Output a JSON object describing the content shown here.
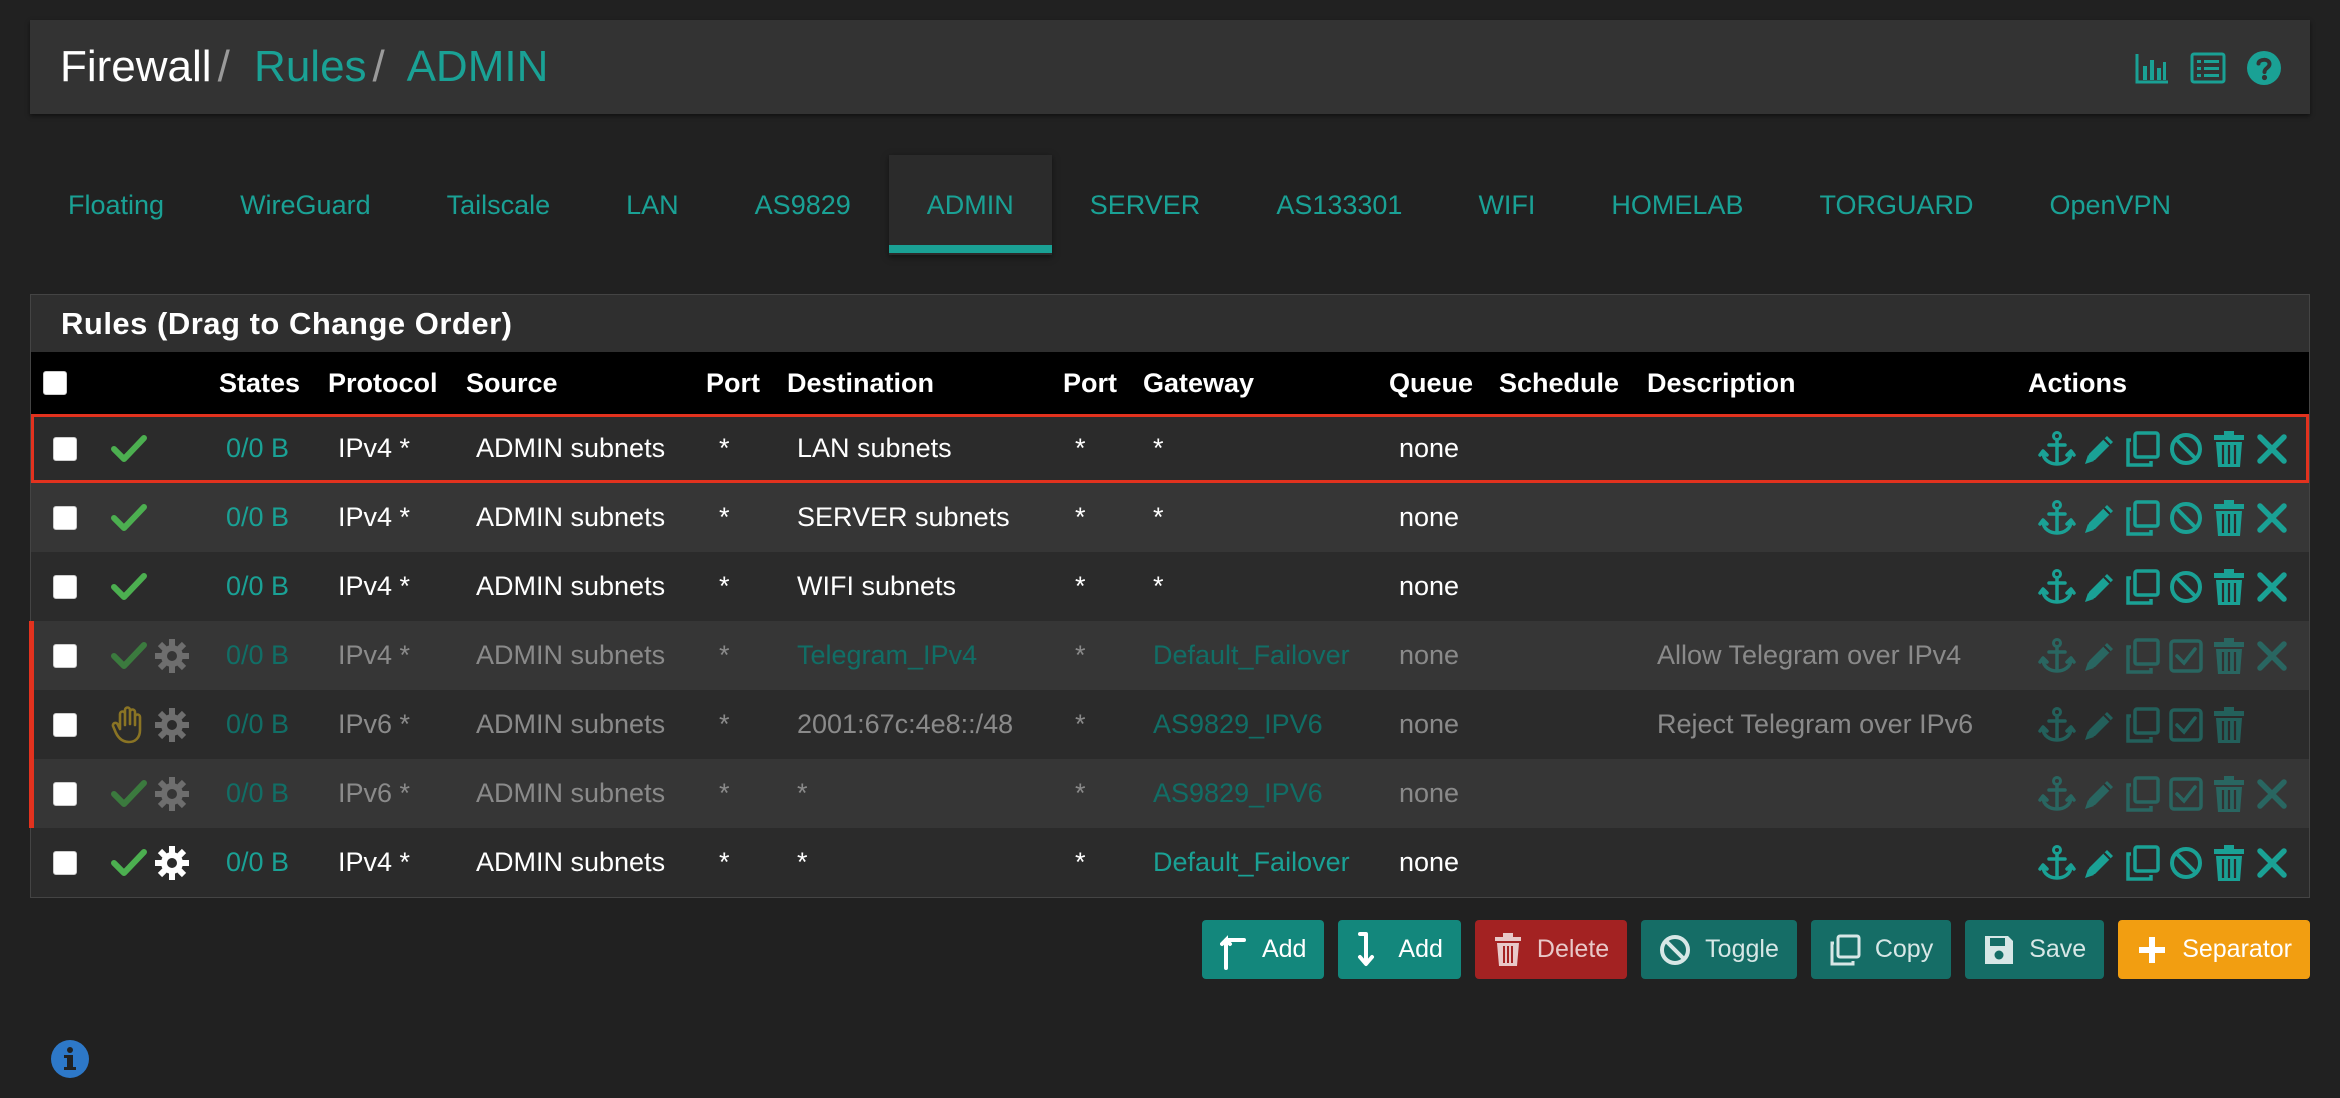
{
  "breadcrumb": {
    "items": [
      {
        "label": "Firewall"
      },
      {
        "label": "Rules"
      },
      {
        "label": "ADMIN"
      }
    ],
    "separator": "/"
  },
  "header_icons": [
    "chart-icon",
    "list-icon",
    "help-icon"
  ],
  "tabs": [
    {
      "label": "Floating",
      "active": false
    },
    {
      "label": "WireGuard",
      "active": false
    },
    {
      "label": "Tailscale",
      "active": false
    },
    {
      "label": "LAN",
      "active": false
    },
    {
      "label": "AS9829",
      "active": false
    },
    {
      "label": "ADMIN",
      "active": true
    },
    {
      "label": "SERVER",
      "active": false
    },
    {
      "label": "AS133301",
      "active": false
    },
    {
      "label": "WIFI",
      "active": false
    },
    {
      "label": "HOMELAB",
      "active": false
    },
    {
      "label": "TORGUARD",
      "active": false
    },
    {
      "label": "OpenVPN",
      "active": false
    }
  ],
  "panel": {
    "title": "Rules (Drag to Change Order)",
    "columns": {
      "states": "States",
      "protocol": "Protocol",
      "source": "Source",
      "port1": "Port",
      "destination": "Destination",
      "port2": "Port",
      "gateway": "Gateway",
      "queue": "Queue",
      "schedule": "Schedule",
      "description": "Description",
      "actions": "Actions"
    }
  },
  "rows": [
    {
      "status": "pass",
      "gear": false,
      "disabled": false,
      "highlighted": true,
      "states": "0/0 B",
      "protocol": "IPv4 *",
      "source": "ADMIN subnets",
      "port1": "*",
      "destination": "LAN subnets",
      "destination_link": false,
      "port2": "*",
      "gateway": "*",
      "gateway_link": false,
      "queue": "none",
      "schedule": "",
      "description": "",
      "toggle": "disable",
      "delete_rule": true
    },
    {
      "status": "pass",
      "gear": false,
      "disabled": false,
      "highlighted": false,
      "states": "0/0 B",
      "protocol": "IPv4 *",
      "source": "ADMIN subnets",
      "port1": "*",
      "destination": "SERVER subnets",
      "destination_link": false,
      "port2": "*",
      "gateway": "*",
      "gateway_link": false,
      "queue": "none",
      "schedule": "",
      "description": "",
      "toggle": "disable",
      "delete_rule": true
    },
    {
      "status": "pass",
      "gear": false,
      "disabled": false,
      "highlighted": false,
      "states": "0/0 B",
      "protocol": "IPv4 *",
      "source": "ADMIN subnets",
      "port1": "*",
      "destination": "WIFI subnets",
      "destination_link": false,
      "port2": "*",
      "gateway": "*",
      "gateway_link": false,
      "queue": "none",
      "schedule": "",
      "description": "",
      "toggle": "disable",
      "delete_rule": true
    },
    {
      "status": "pass",
      "gear": true,
      "disabled": true,
      "highlighted": false,
      "states": "0/0 B",
      "protocol": "IPv4 *",
      "source": "ADMIN subnets",
      "port1": "*",
      "destination": "Telegram_IPv4",
      "destination_link": true,
      "port2": "*",
      "gateway": "Default_Failover",
      "gateway_link": true,
      "queue": "none",
      "schedule": "",
      "description": "Allow Telegram over IPv4",
      "toggle": "enable",
      "delete_rule": true
    },
    {
      "status": "reject",
      "gear": true,
      "disabled": true,
      "highlighted": false,
      "states": "0/0 B",
      "protocol": "IPv6 *",
      "source": "ADMIN subnets",
      "port1": "*",
      "destination": "2001:67c:4e8::/48",
      "destination_link": false,
      "port2": "*",
      "gateway": "AS9829_IPV6",
      "gateway_link": true,
      "queue": "none",
      "schedule": "",
      "description": "Reject Telegram over IPv6",
      "toggle": "enable",
      "delete_rule": false
    },
    {
      "status": "pass",
      "gear": true,
      "disabled": true,
      "highlighted": false,
      "states": "0/0 B",
      "protocol": "IPv6 *",
      "source": "ADMIN subnets",
      "port1": "*",
      "destination": "*",
      "destination_link": false,
      "port2": "*",
      "gateway": "AS9829_IPV6",
      "gateway_link": true,
      "queue": "none",
      "schedule": "",
      "description": "",
      "toggle": "enable",
      "delete_rule": true
    },
    {
      "status": "pass",
      "gear": true,
      "disabled": false,
      "highlighted": false,
      "states": "0/0 B",
      "protocol": "IPv4 *",
      "source": "ADMIN subnets",
      "port1": "*",
      "destination": "*",
      "destination_link": false,
      "port2": "*",
      "gateway": "Default_Failover",
      "gateway_link": true,
      "queue": "none",
      "schedule": "",
      "description": "",
      "toggle": "disable",
      "delete_rule": true
    }
  ],
  "buttons": {
    "add_top": "Add",
    "add_bottom": "Add",
    "delete": "Delete",
    "toggle": "Toggle",
    "copy": "Copy",
    "save": "Save",
    "separator": "Separator"
  },
  "colors": {
    "accent": "#1aa195",
    "pass": "#4caf50",
    "reject": "#c8a020",
    "highlight": "#e2321e",
    "separator_button": "#f29e11",
    "delete_button": "#a32222"
  }
}
